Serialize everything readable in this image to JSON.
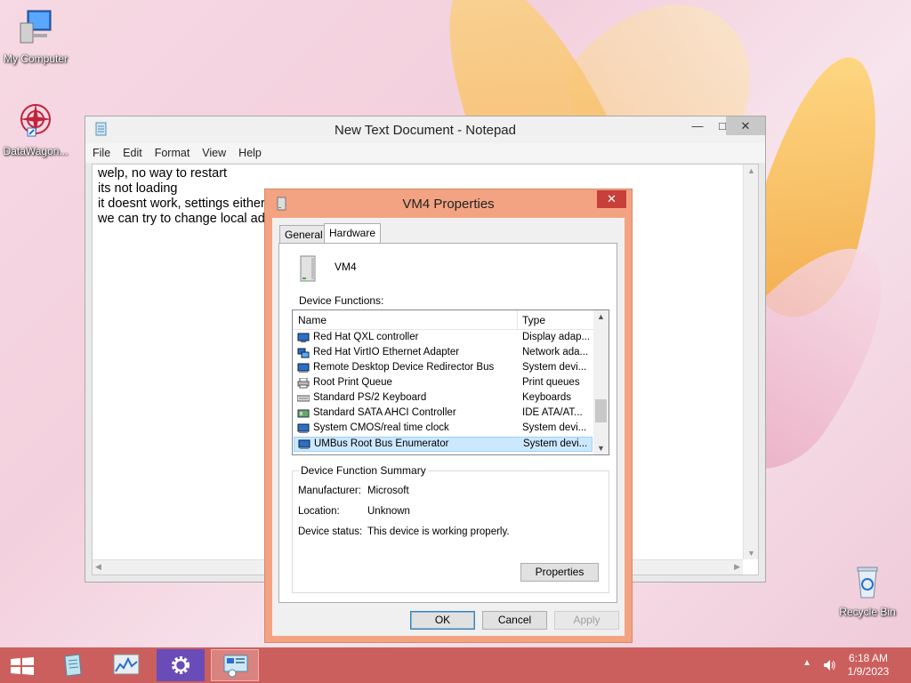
{
  "desktop": {
    "icons": [
      {
        "label": "My Computer"
      },
      {
        "label": "DataWagon..."
      },
      {
        "label": "Recycle Bin"
      }
    ]
  },
  "notepad": {
    "title": "New Text Document - Notepad",
    "menu": [
      "File",
      "Edit",
      "Format",
      "View",
      "Help"
    ],
    "text": "welp, no way to restart\nits not loading\nit doesnt work, settings either\nwe can try to change local ad"
  },
  "dialog": {
    "title": "VM4 Properties",
    "tabs": [
      "General",
      "Hardware"
    ],
    "device_name": "VM4",
    "device_functions_label": "Device Functions:",
    "columns": {
      "name": "Name",
      "type": "Type"
    },
    "rows": [
      {
        "name": "Red Hat QXL controller",
        "type": "Display adap...",
        "icon": "display-adapter-icon"
      },
      {
        "name": "Red Hat VirtIO Ethernet Adapter",
        "type": "Network ada...",
        "icon": "network-adapter-icon"
      },
      {
        "name": "Remote Desktop Device Redirector Bus",
        "type": "System devi...",
        "icon": "system-device-icon"
      },
      {
        "name": "Root Print Queue",
        "type": "Print queues",
        "icon": "printer-icon"
      },
      {
        "name": "Standard PS/2 Keyboard",
        "type": "Keyboards",
        "icon": "keyboard-icon"
      },
      {
        "name": "Standard SATA AHCI Controller",
        "type": "IDE ATA/AT...",
        "icon": "storage-controller-icon"
      },
      {
        "name": "System CMOS/real time clock",
        "type": "System devi...",
        "icon": "system-device-icon"
      },
      {
        "name": "UMBus Root Bus Enumerator",
        "type": "System devi...",
        "icon": "system-device-icon",
        "selected": true
      }
    ],
    "summary": {
      "title": "Device Function Summary",
      "manufacturer_label": "Manufacturer:",
      "manufacturer": "Microsoft",
      "location_label": "Location:",
      "location": "Unknown",
      "status_label": "Device status:",
      "status": "This device is working properly."
    },
    "properties_button": "Properties",
    "ok": "OK",
    "cancel": "Cancel",
    "apply": "Apply"
  },
  "taskbar": {
    "time": "6:18 AM",
    "date": "1/9/2023"
  },
  "colors": {
    "taskbar": "#cb5f5d",
    "dialog_frame": "#f3a382",
    "selection": "#cce8ff"
  }
}
